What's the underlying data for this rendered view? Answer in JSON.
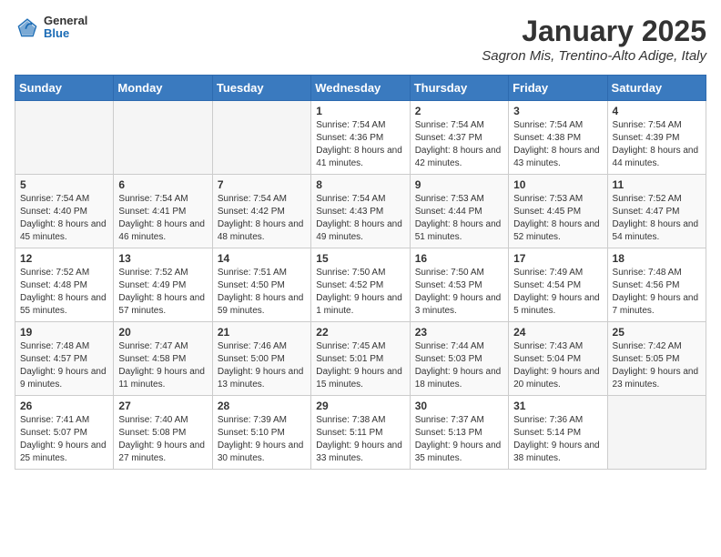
{
  "header": {
    "logo_general": "General",
    "logo_blue": "Blue",
    "month_title": "January 2025",
    "location": "Sagron Mis, Trentino-Alto Adige, Italy"
  },
  "days_of_week": [
    "Sunday",
    "Monday",
    "Tuesday",
    "Wednesday",
    "Thursday",
    "Friday",
    "Saturday"
  ],
  "weeks": [
    [
      {
        "day": "",
        "info": ""
      },
      {
        "day": "",
        "info": ""
      },
      {
        "day": "",
        "info": ""
      },
      {
        "day": "1",
        "info": "Sunrise: 7:54 AM\nSunset: 4:36 PM\nDaylight: 8 hours and 41 minutes."
      },
      {
        "day": "2",
        "info": "Sunrise: 7:54 AM\nSunset: 4:37 PM\nDaylight: 8 hours and 42 minutes."
      },
      {
        "day": "3",
        "info": "Sunrise: 7:54 AM\nSunset: 4:38 PM\nDaylight: 8 hours and 43 minutes."
      },
      {
        "day": "4",
        "info": "Sunrise: 7:54 AM\nSunset: 4:39 PM\nDaylight: 8 hours and 44 minutes."
      }
    ],
    [
      {
        "day": "5",
        "info": "Sunrise: 7:54 AM\nSunset: 4:40 PM\nDaylight: 8 hours and 45 minutes."
      },
      {
        "day": "6",
        "info": "Sunrise: 7:54 AM\nSunset: 4:41 PM\nDaylight: 8 hours and 46 minutes."
      },
      {
        "day": "7",
        "info": "Sunrise: 7:54 AM\nSunset: 4:42 PM\nDaylight: 8 hours and 48 minutes."
      },
      {
        "day": "8",
        "info": "Sunrise: 7:54 AM\nSunset: 4:43 PM\nDaylight: 8 hours and 49 minutes."
      },
      {
        "day": "9",
        "info": "Sunrise: 7:53 AM\nSunset: 4:44 PM\nDaylight: 8 hours and 51 minutes."
      },
      {
        "day": "10",
        "info": "Sunrise: 7:53 AM\nSunset: 4:45 PM\nDaylight: 8 hours and 52 minutes."
      },
      {
        "day": "11",
        "info": "Sunrise: 7:52 AM\nSunset: 4:47 PM\nDaylight: 8 hours and 54 minutes."
      }
    ],
    [
      {
        "day": "12",
        "info": "Sunrise: 7:52 AM\nSunset: 4:48 PM\nDaylight: 8 hours and 55 minutes."
      },
      {
        "day": "13",
        "info": "Sunrise: 7:52 AM\nSunset: 4:49 PM\nDaylight: 8 hours and 57 minutes."
      },
      {
        "day": "14",
        "info": "Sunrise: 7:51 AM\nSunset: 4:50 PM\nDaylight: 8 hours and 59 minutes."
      },
      {
        "day": "15",
        "info": "Sunrise: 7:50 AM\nSunset: 4:52 PM\nDaylight: 9 hours and 1 minute."
      },
      {
        "day": "16",
        "info": "Sunrise: 7:50 AM\nSunset: 4:53 PM\nDaylight: 9 hours and 3 minutes."
      },
      {
        "day": "17",
        "info": "Sunrise: 7:49 AM\nSunset: 4:54 PM\nDaylight: 9 hours and 5 minutes."
      },
      {
        "day": "18",
        "info": "Sunrise: 7:48 AM\nSunset: 4:56 PM\nDaylight: 9 hours and 7 minutes."
      }
    ],
    [
      {
        "day": "19",
        "info": "Sunrise: 7:48 AM\nSunset: 4:57 PM\nDaylight: 9 hours and 9 minutes."
      },
      {
        "day": "20",
        "info": "Sunrise: 7:47 AM\nSunset: 4:58 PM\nDaylight: 9 hours and 11 minutes."
      },
      {
        "day": "21",
        "info": "Sunrise: 7:46 AM\nSunset: 5:00 PM\nDaylight: 9 hours and 13 minutes."
      },
      {
        "day": "22",
        "info": "Sunrise: 7:45 AM\nSunset: 5:01 PM\nDaylight: 9 hours and 15 minutes."
      },
      {
        "day": "23",
        "info": "Sunrise: 7:44 AM\nSunset: 5:03 PM\nDaylight: 9 hours and 18 minutes."
      },
      {
        "day": "24",
        "info": "Sunrise: 7:43 AM\nSunset: 5:04 PM\nDaylight: 9 hours and 20 minutes."
      },
      {
        "day": "25",
        "info": "Sunrise: 7:42 AM\nSunset: 5:05 PM\nDaylight: 9 hours and 23 minutes."
      }
    ],
    [
      {
        "day": "26",
        "info": "Sunrise: 7:41 AM\nSunset: 5:07 PM\nDaylight: 9 hours and 25 minutes."
      },
      {
        "day": "27",
        "info": "Sunrise: 7:40 AM\nSunset: 5:08 PM\nDaylight: 9 hours and 27 minutes."
      },
      {
        "day": "28",
        "info": "Sunrise: 7:39 AM\nSunset: 5:10 PM\nDaylight: 9 hours and 30 minutes."
      },
      {
        "day": "29",
        "info": "Sunrise: 7:38 AM\nSunset: 5:11 PM\nDaylight: 9 hours and 33 minutes."
      },
      {
        "day": "30",
        "info": "Sunrise: 7:37 AM\nSunset: 5:13 PM\nDaylight: 9 hours and 35 minutes."
      },
      {
        "day": "31",
        "info": "Sunrise: 7:36 AM\nSunset: 5:14 PM\nDaylight: 9 hours and 38 minutes."
      },
      {
        "day": "",
        "info": ""
      }
    ]
  ]
}
